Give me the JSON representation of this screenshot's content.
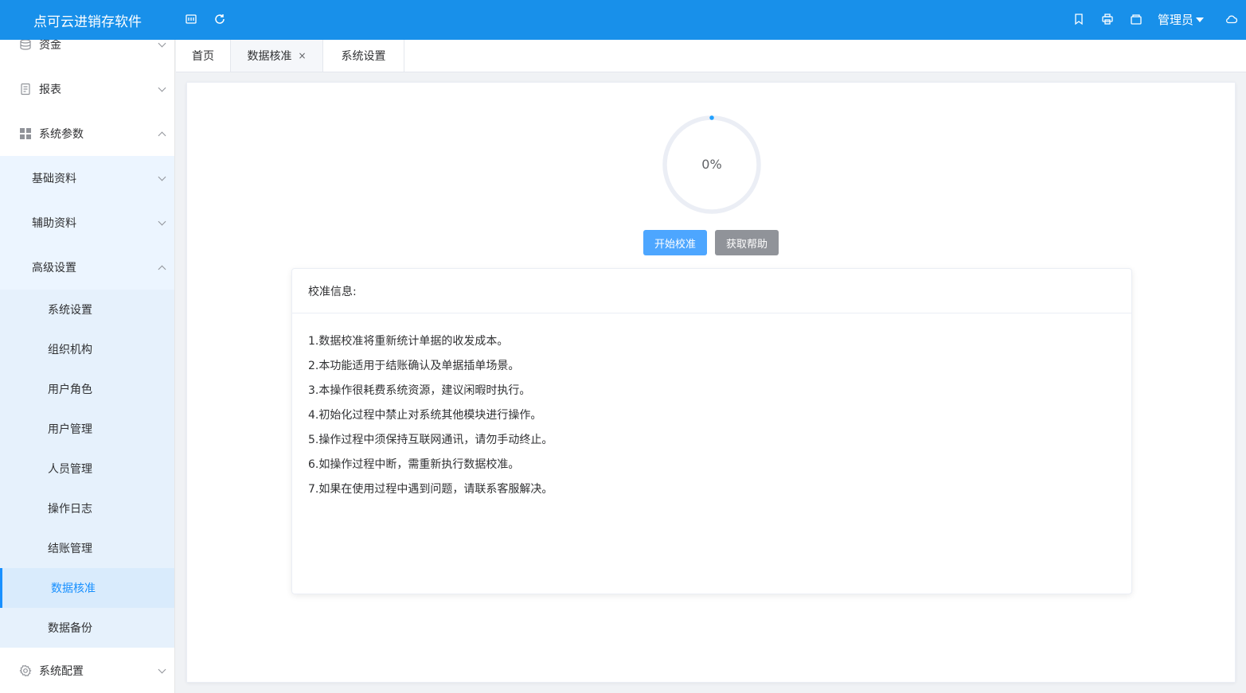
{
  "app": {
    "title": "点可云进销存软件"
  },
  "header": {
    "icons": [
      "window-icon",
      "refresh-icon",
      "bookmark-icon",
      "print-icon",
      "wallet-icon",
      "cloud-icon"
    ],
    "user": "管理员"
  },
  "sidebar": {
    "items": [
      {
        "label": "资金",
        "icon": "database-icon"
      },
      {
        "label": "报表",
        "icon": "document-icon"
      },
      {
        "label": "系统参数",
        "icon": "grid-icon"
      },
      {
        "label": "系统配置",
        "icon": "gear-icon"
      }
    ],
    "submenus": [
      {
        "label": "基础资料"
      },
      {
        "label": "辅助资料"
      },
      {
        "label": "高级设置"
      }
    ],
    "advanced_items": [
      {
        "label": "系统设置"
      },
      {
        "label": "组织机构"
      },
      {
        "label": "用户角色"
      },
      {
        "label": "用户管理"
      },
      {
        "label": "人员管理"
      },
      {
        "label": "操作日志"
      },
      {
        "label": "结账管理"
      },
      {
        "label": "数据核准"
      },
      {
        "label": "数据备份"
      }
    ],
    "active_item": "数据核准"
  },
  "tabs": [
    {
      "label": "首页"
    },
    {
      "label": "数据核准",
      "close": "×"
    },
    {
      "label": "系统设置"
    }
  ],
  "main": {
    "progress": {
      "value": 0,
      "label": "0%"
    },
    "start_button": "开始校准",
    "help_button": "获取帮助",
    "info_title": "校准信息:",
    "info_lines": [
      "1.数据校准将重新统计单据的收发成本。",
      "2.本功能适用于结账确认及单据插单场景。",
      "3.本操作很耗费系统资源，建议闲暇时执行。",
      "4.初始化过程中禁止对系统其他模块进行操作。",
      "5.操作过程中须保持互联网通讯，请勿手动终止。",
      "6.如操作过程中断，需重新执行数据校准。",
      "7.如果在使用过程中遇到问题，请联系客服解决。"
    ]
  },
  "colors": {
    "header": "#1890ea",
    "primary_button": "#4da6ff",
    "info_button": "#909399",
    "active_menu": "#1890ff"
  }
}
